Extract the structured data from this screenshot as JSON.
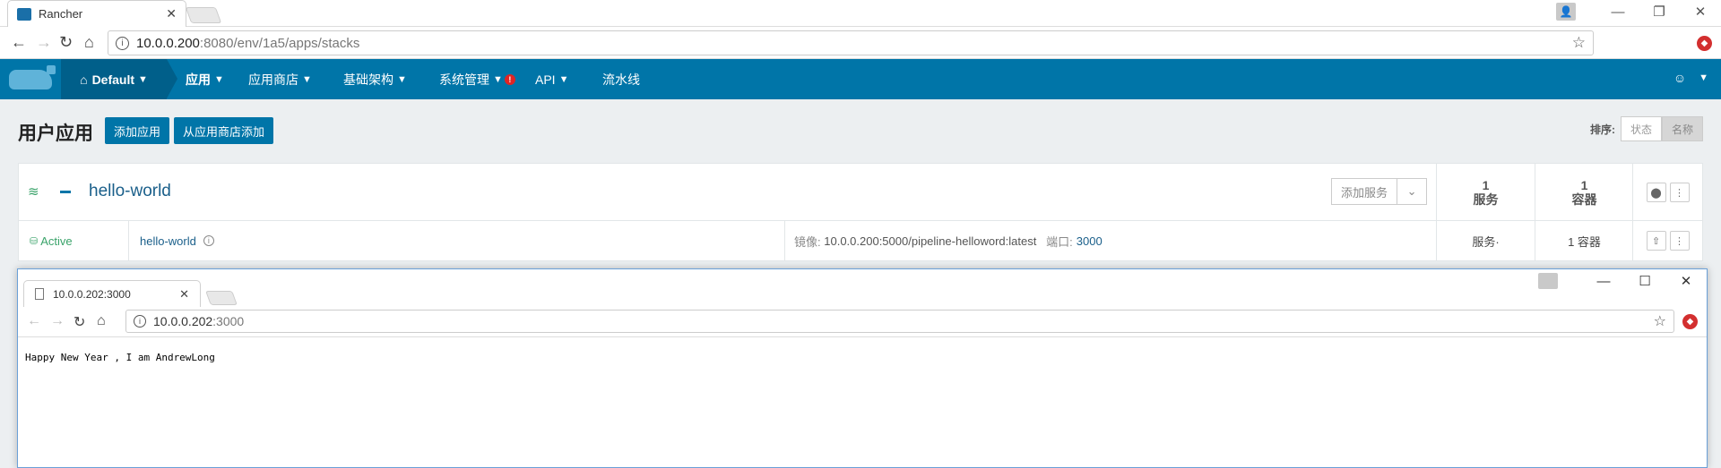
{
  "browser1": {
    "tab_title": "Rancher",
    "tab_close": "✕",
    "url_host": "10.0.0.200",
    "url_path": ":8080/env/1a5/apps/stacks",
    "win_min": "—",
    "win_max": "❐",
    "win_close": "✕"
  },
  "rancher_nav": {
    "env": "Default",
    "menu": [
      {
        "label": "应用"
      },
      {
        "label": "应用商店"
      },
      {
        "label": "基础架构"
      },
      {
        "label": "系统管理"
      },
      {
        "label": "API"
      },
      {
        "label": "流水线"
      }
    ],
    "alert": "!"
  },
  "page": {
    "title": "用户应用",
    "add_stack": "添加应用",
    "add_from_catalog": "从应用商店添加",
    "sort_label": "排序:",
    "sort_state": "状态",
    "sort_name": "名称"
  },
  "stack": {
    "name": "hello-world",
    "add_service": "添加服务",
    "services_count": "1",
    "services_label": "服务",
    "containers_count": "1",
    "containers_label": "容器"
  },
  "service_row": {
    "state": "Active",
    "name": "hello-world",
    "image_label": "镜像:",
    "image": "10.0.0.200:5000/pipeline-helloword:latest",
    "port_label": "端口:",
    "port": "3000",
    "services_cell": "服务·",
    "containers_cell": "1 容器"
  },
  "browser2": {
    "tab_title": "10.0.0.202:3000",
    "tab_close": "✕",
    "url_host": "10.0.0.202",
    "url_path": ":3000",
    "page_text": "Happy New Year , I am AndrewLong",
    "win_min": "—",
    "win_max": "☐",
    "win_close": "✕"
  }
}
